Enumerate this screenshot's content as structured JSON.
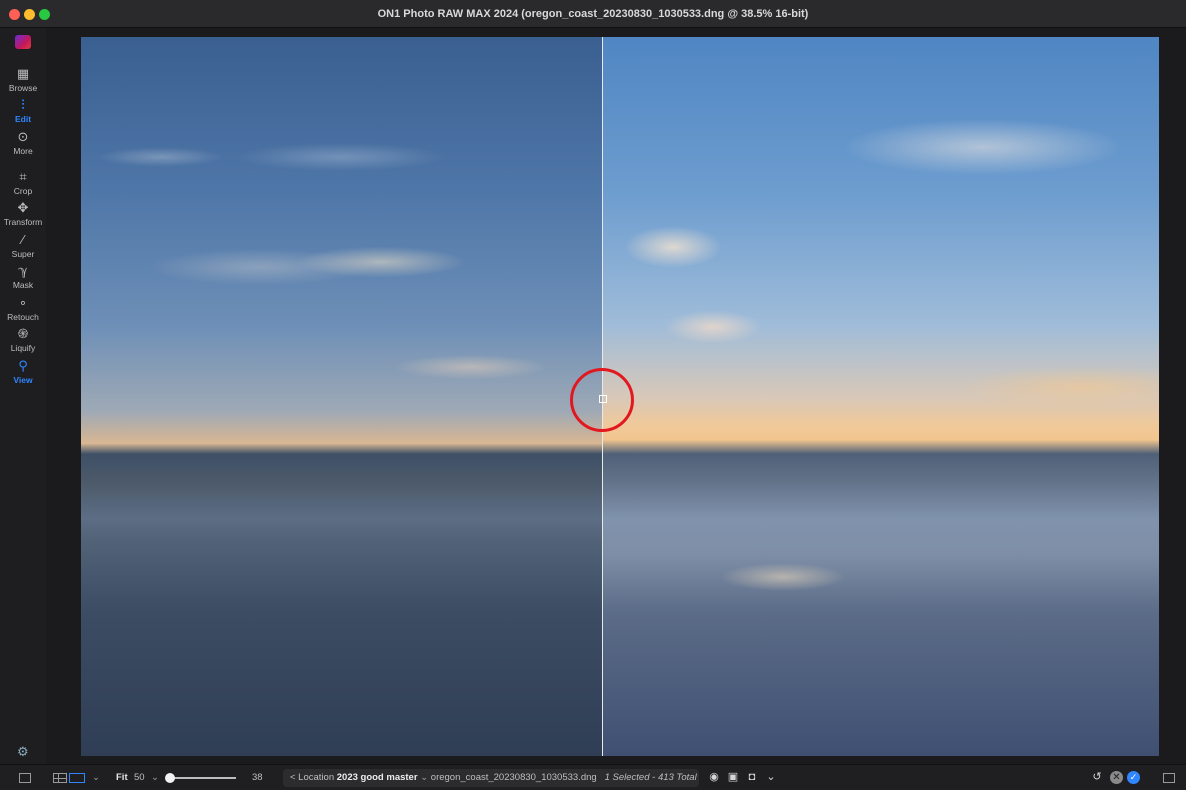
{
  "window": {
    "title": "ON1 Photo RAW MAX 2024 (oregon_coast_20230830_1030533.dng @ 38.5% 16-bit)"
  },
  "sidebar": {
    "items": [
      {
        "label": "Browse",
        "icon": "browse-icon"
      },
      {
        "label": "Edit",
        "icon": "edit-sliders-icon",
        "active": true
      },
      {
        "label": "More",
        "icon": "more-icon"
      },
      {
        "label": "Crop",
        "icon": "crop-icon"
      },
      {
        "label": "Transform",
        "icon": "transform-icon"
      },
      {
        "label": "Super",
        "icon": "magic-wand-icon"
      },
      {
        "label": "Mask",
        "icon": "mask-brush-icon"
      },
      {
        "label": "Retouch",
        "icon": "retouch-icon"
      },
      {
        "label": "Liquify",
        "icon": "liquify-icon"
      },
      {
        "label": "View",
        "icon": "zoom-view-icon",
        "active": true
      }
    ],
    "accent_color": "#2f86ff"
  },
  "bottombar": {
    "fit_label": "Fit",
    "zoom_value": "50",
    "slider_value": "38",
    "location_prefix": "< Location",
    "location_name": "2023 good master",
    "filename": "oregon_coast_20230830_1030533.dng",
    "selection_text": "1 Selected - 413 Total"
  }
}
